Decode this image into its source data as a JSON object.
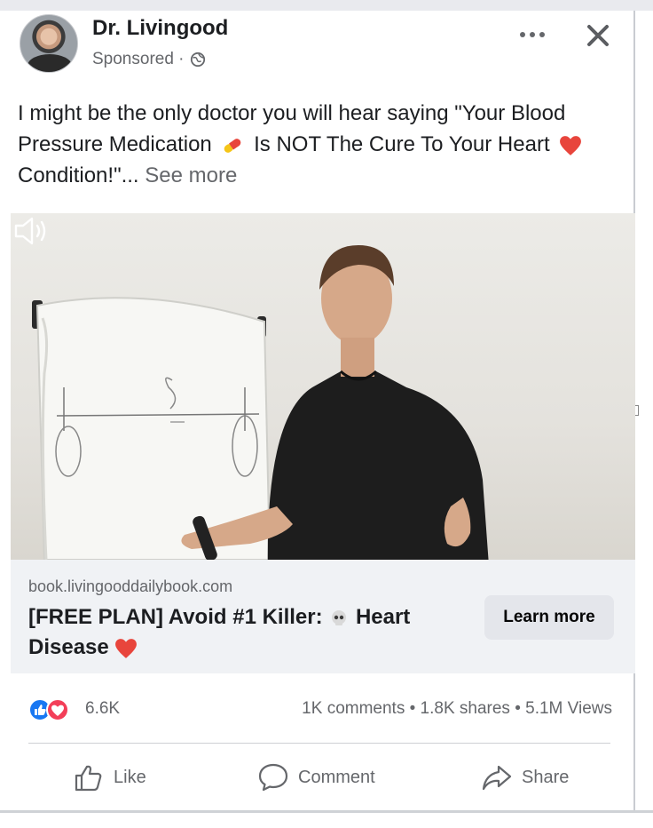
{
  "post": {
    "author": "Dr. Livingood",
    "sponsored_label": "Sponsored · ",
    "text_part1": "I might be the only doctor you will hear saying \"Your Blood Pressure Medication",
    "text_part2": "Is NOT The Cure To Your Heart",
    "text_part3": "Condition!\"...",
    "see_more": "See more"
  },
  "link_preview": {
    "domain": "book.livingooddailybook.com",
    "title_part1": "[FREE PLAN] Avoid #1 Killer:",
    "title_part2": "Heart Disease",
    "cta_label": "Learn more"
  },
  "stats": {
    "reactions": "6.6K",
    "summary": "1K comments • 1.8K shares • 5.1M Views"
  },
  "actions": {
    "like": "Like",
    "comment": "Comment",
    "share": "Share"
  },
  "icons": {
    "globe": "globe-icon",
    "more": "more-options-icon",
    "close": "close-icon",
    "volume": "volume-icon",
    "like": "thumbs-up-icon",
    "comment": "comment-bubble-icon",
    "share": "share-arrow-icon",
    "pill_emoji": "pill-emoji",
    "heart_emoji": "red-heart-emoji",
    "skull_emoji": "skull-emoji"
  },
  "colors": {
    "like_blue": "#1877f2",
    "love_red": "#f33e58",
    "text_secondary": "#65676b"
  }
}
